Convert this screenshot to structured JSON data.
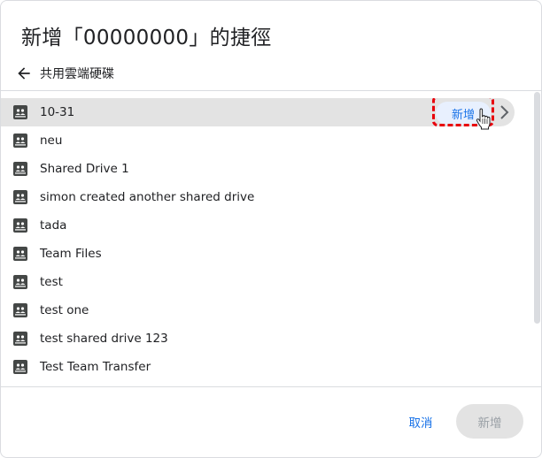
{
  "dialog": {
    "title": "新增「00000000」的捷徑",
    "back_icon": "arrow-left-icon",
    "breadcrumb": "共用雲端硬碟"
  },
  "drives": [
    {
      "label": "10-31",
      "selected": true
    },
    {
      "label": "neu"
    },
    {
      "label": "Shared Drive 1"
    },
    {
      "label": "simon created another shared drive"
    },
    {
      "label": "tada"
    },
    {
      "label": "Team Files"
    },
    {
      "label": "test"
    },
    {
      "label": "test one"
    },
    {
      "label": "test shared drive 123"
    },
    {
      "label": "Test Team Transfer"
    }
  ],
  "row_actions": {
    "add_label": "新增",
    "chevron_icon": "chevron-right-icon"
  },
  "footer": {
    "cancel_label": "取消",
    "add_label": "新增",
    "add_disabled": true
  },
  "colors": {
    "accent": "#1a73e8",
    "selected_row": "#e3e3e3",
    "highlight": "#e8000b",
    "chip_bg": "#e8f0fe"
  }
}
